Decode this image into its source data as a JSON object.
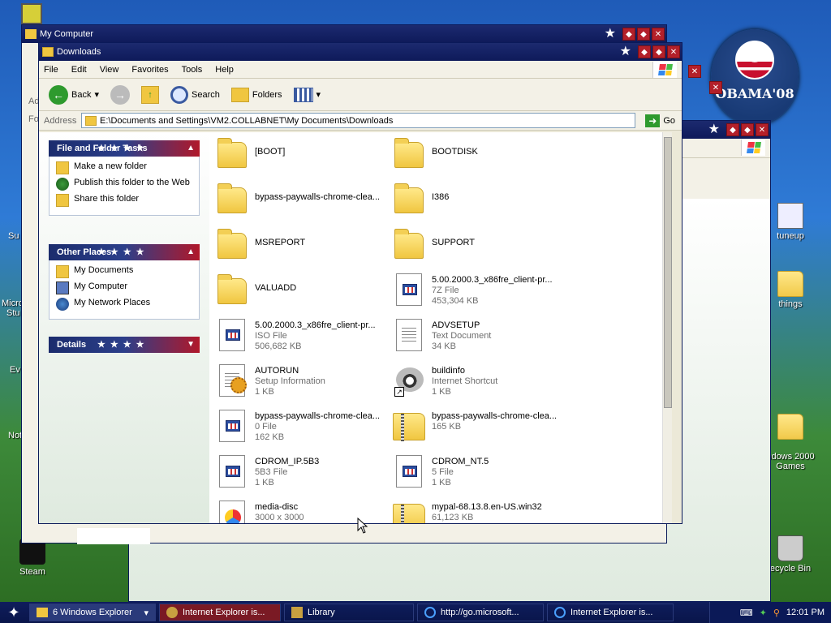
{
  "desktop": {
    "icons": [
      {
        "name": "steam",
        "label": "Steam"
      },
      {
        "name": "tuneup",
        "label": "tuneup"
      },
      {
        "name": "things",
        "label": "things"
      },
      {
        "name": "windows2000games",
        "label": "ndows 2000\nGames"
      },
      {
        "name": "recycle",
        "label": "ecycle Bin"
      }
    ],
    "left_fragments": [
      "Su",
      "Micro",
      "Stu",
      "Ev",
      "Not"
    ],
    "obama_text": "OBAMA'08"
  },
  "back_window": {
    "title": "My Computer",
    "addr_label_fragment": "Ad",
    "fo_fragment": "Fo",
    "go_label": "Go"
  },
  "window": {
    "title": "Downloads",
    "menu": [
      "File",
      "Edit",
      "View",
      "Favorites",
      "Tools",
      "Help"
    ],
    "toolbar": {
      "back": "Back",
      "search": "Search",
      "folders": "Folders"
    },
    "address": {
      "label": "Address",
      "value": "E:\\Documents and Settings\\VM2.COLLABNET\\My Documents\\Downloads",
      "go": "Go"
    },
    "tasks": {
      "file_folder_tasks": {
        "title": "File and Folder Tasks",
        "items": [
          "Make a new folder",
          "Publish this folder to the Web",
          "Share this folder"
        ]
      },
      "other_places": {
        "title": "Other Places",
        "items": [
          "My Documents",
          "My Computer",
          "My Network Places"
        ]
      },
      "details": {
        "title": "Details"
      }
    },
    "files": [
      {
        "name": "[BOOT]",
        "type": "",
        "size": "",
        "kind": "folder"
      },
      {
        "name": "BOOTDISK",
        "type": "",
        "size": "",
        "kind": "folder"
      },
      {
        "name": "bypass-paywalls-chrome-clea...",
        "type": "",
        "size": "",
        "kind": "folder"
      },
      {
        "name": "I386",
        "type": "",
        "size": "",
        "kind": "folder"
      },
      {
        "name": "MSREPORT",
        "type": "",
        "size": "",
        "kind": "folder"
      },
      {
        "name": "SUPPORT",
        "type": "",
        "size": "",
        "kind": "folder"
      },
      {
        "name": "VALUADD",
        "type": "",
        "size": "",
        "kind": "folder"
      },
      {
        "name": "5.00.2000.3_x86fre_client-pr...",
        "type": "7Z File",
        "size": "453,304 KB",
        "kind": "appdoc"
      },
      {
        "name": "5.00.2000.3_x86fre_client-pr...",
        "type": "ISO File",
        "size": "506,682 KB",
        "kind": "appdoc"
      },
      {
        "name": "ADVSETUP",
        "type": "Text Document",
        "size": "34 KB",
        "kind": "text"
      },
      {
        "name": "AUTORUN",
        "type": "Setup Information",
        "size": "1 KB",
        "kind": "setup"
      },
      {
        "name": "buildinfo",
        "type": "Internet Shortcut",
        "size": "1 KB",
        "kind": "shortcut"
      },
      {
        "name": "bypass-paywalls-chrome-clea...",
        "type": "0 File",
        "size": "162 KB",
        "kind": "appdoc"
      },
      {
        "name": "bypass-paywalls-chrome-clea...",
        "type": "165 KB",
        "size": "",
        "kind": "zip"
      },
      {
        "name": "CDROM_IP.5B3",
        "type": "5B3 File",
        "size": "1 KB",
        "kind": "appdoc"
      },
      {
        "name": "CDROM_NT.5",
        "type": "5 File",
        "size": "1 KB",
        "kind": "appdoc"
      },
      {
        "name": "media-disc",
        "type": "3000 x 3000",
        "size": "",
        "kind": "image"
      },
      {
        "name": "mypal-68.13.8.en-US.win32",
        "type": "61,123 KB",
        "size": "",
        "kind": "zip"
      }
    ]
  },
  "taskbar": {
    "items": [
      {
        "label": "6 Windows Explorer"
      },
      {
        "label": "Internet Explorer is..."
      },
      {
        "label": "Library"
      },
      {
        "label": "http://go.microsoft..."
      },
      {
        "label": "Internet Explorer is..."
      }
    ],
    "clock": "12:01 PM"
  }
}
